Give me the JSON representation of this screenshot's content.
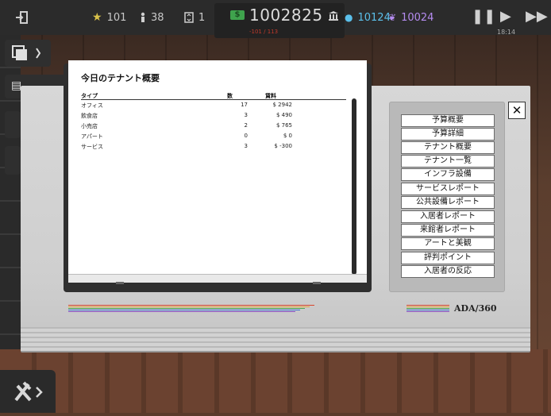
{
  "topbar": {
    "stars": "101",
    "population": "38",
    "elevators": "1",
    "money": "1002825",
    "money_delta": "-101 / 113",
    "stat_blue": "10124",
    "stat_purple": "10024",
    "time": "18:14",
    "exit_icon": "exit-door-icon",
    "star_icon": "star-icon",
    "person_icon": "person-icon",
    "elevator_icon": "elevator-icon",
    "bank_icon": "bank-icon"
  },
  "report": {
    "title": "今日のテナント概要",
    "columns": [
      "タイプ",
      "数",
      "賃料"
    ],
    "rows": [
      {
        "type": "オフィス",
        "count": "17",
        "rent": "$ 2942"
      },
      {
        "type": "飲食店",
        "count": "3",
        "rent": "$ 490"
      },
      {
        "type": "小売店",
        "count": "2",
        "rent": "$ 765"
      },
      {
        "type": "アパート",
        "count": "0",
        "rent": "$ 0"
      },
      {
        "type": "サービス",
        "count": "3",
        "rent": "$ -300"
      }
    ]
  },
  "brand": "ADA/360",
  "menu": [
    "予算概要",
    "予算詳細",
    "テナント概要",
    "テナント一覧",
    "インフラ設備",
    "サービスレポート",
    "公共設備レポート",
    "入居者レポート",
    "来館者レポート",
    "アートと美観",
    "評判ポイント",
    "入居者の反応"
  ],
  "close_label": "✕",
  "colors": {
    "cash": "#3fa34d",
    "stat_blue": "#5bc0eb",
    "stat_purple": "#b58cf0",
    "rainbow": [
      "#d9452b",
      "#e8a33a",
      "#4aa84f",
      "#3f6fd1",
      "#8a4fc4"
    ]
  }
}
